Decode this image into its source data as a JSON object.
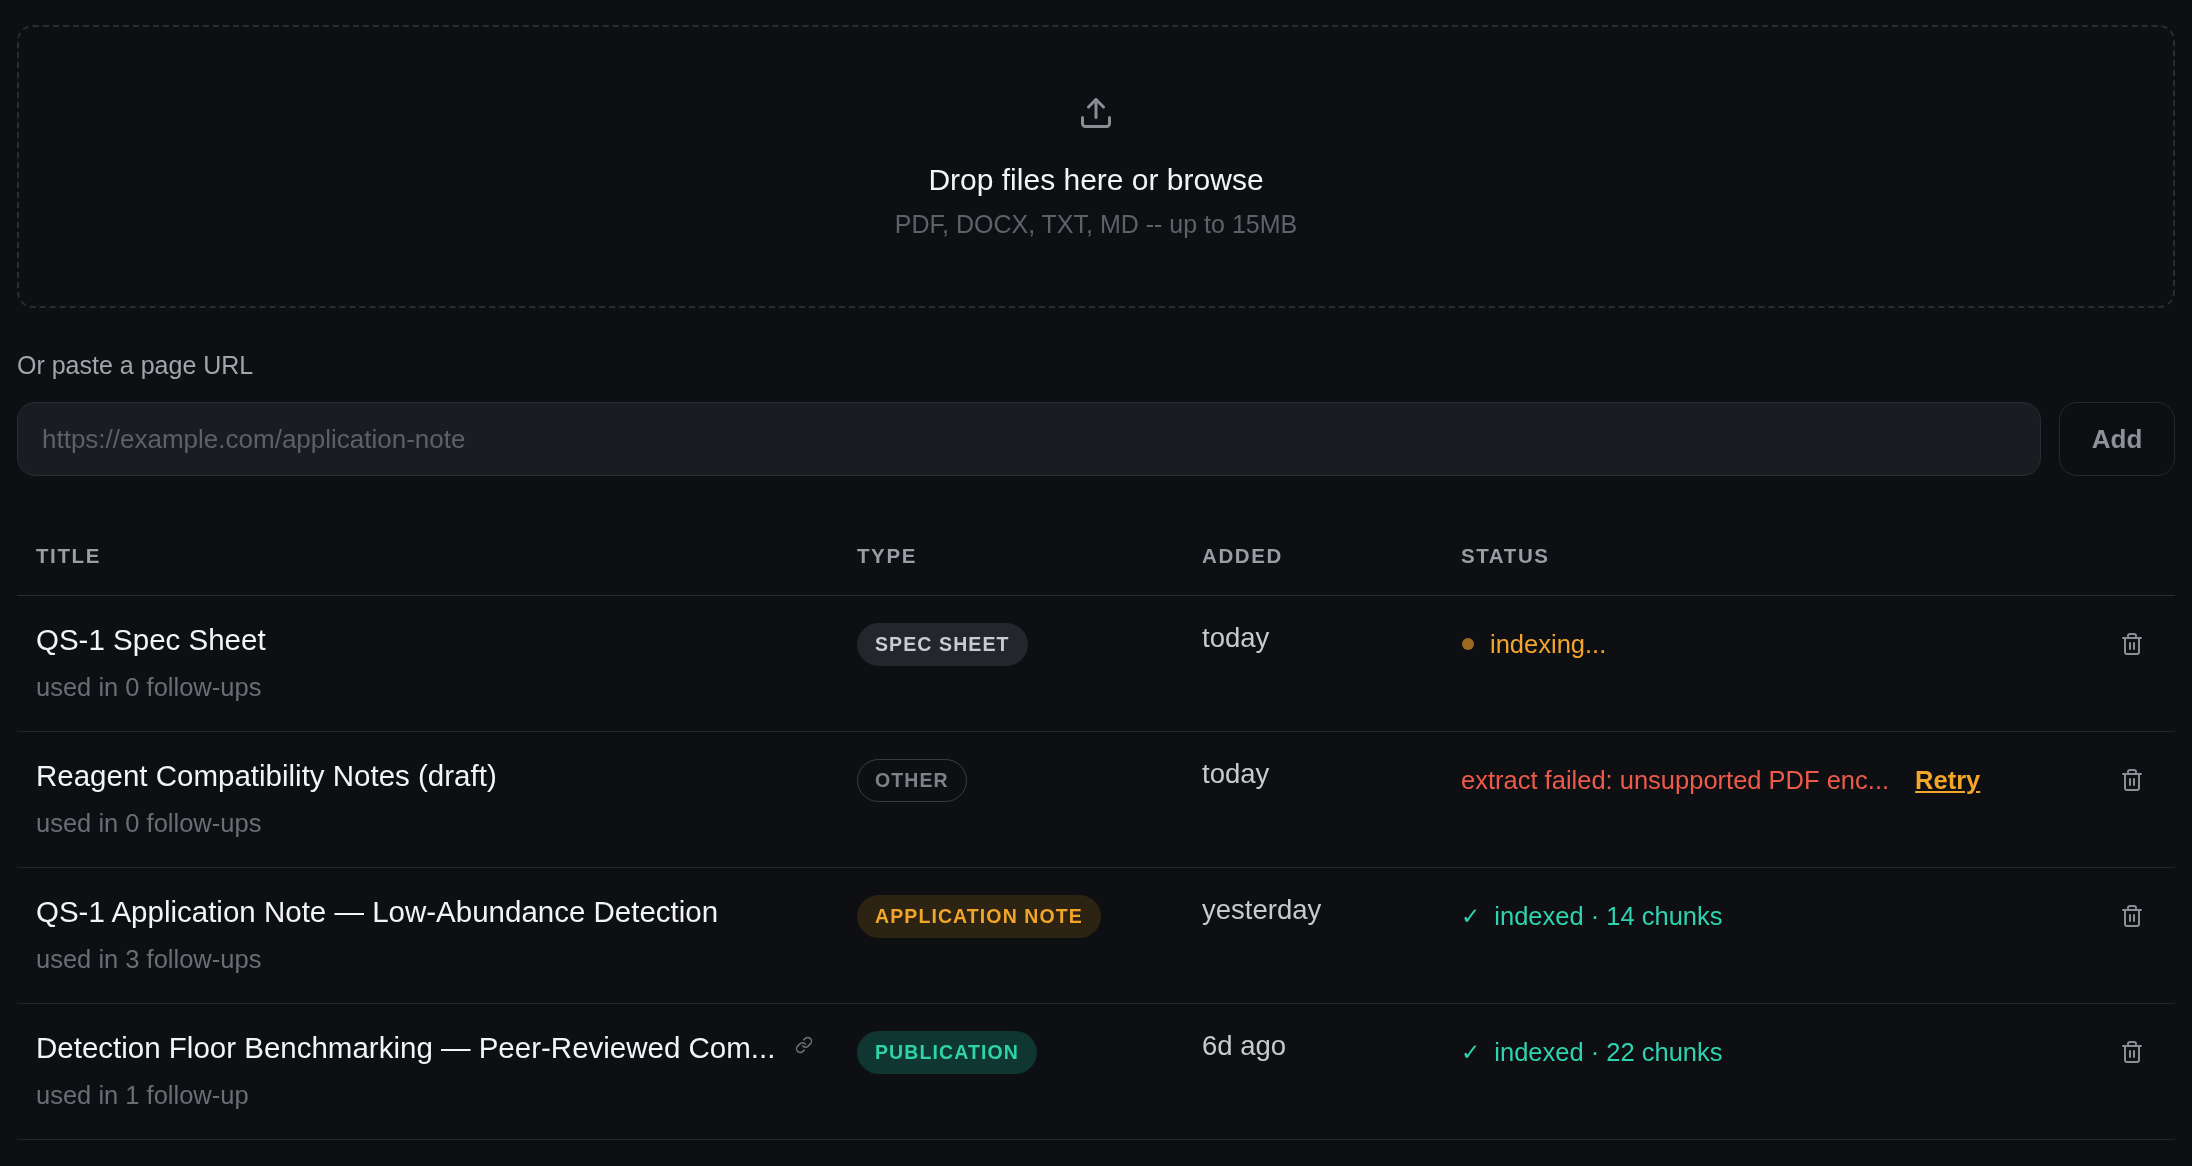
{
  "dropzone": {
    "title": "Drop files here or browse",
    "hint": "PDF, DOCX, TXT, MD -- up to 15MB"
  },
  "url_import": {
    "label": "Or paste a page URL",
    "placeholder": "https://example.com/application-note",
    "button": "Add"
  },
  "table": {
    "columns": [
      "TITLE",
      "TYPE",
      "ADDED",
      "STATUS"
    ],
    "rows": [
      {
        "title": "QS-1 Spec Sheet",
        "usage": "used in 0 follow-ups",
        "linked": false,
        "type": {
          "kind": "spec_sheet",
          "label": "SPEC SHEET"
        },
        "added": "today",
        "status": {
          "kind": "indexing",
          "text": "indexing..."
        }
      },
      {
        "title": "Reagent Compatibility Notes (draft)",
        "usage": "used in 0 follow-ups",
        "linked": false,
        "type": {
          "kind": "other",
          "label": "OTHER"
        },
        "added": "today",
        "status": {
          "kind": "failed",
          "text": "extract failed: unsupported PDF enc...",
          "action": "Retry"
        }
      },
      {
        "title": "QS-1 Application Note — Low-Abundance Detection",
        "usage": "used in 3 follow-ups",
        "linked": false,
        "type": {
          "kind": "application_note",
          "label": "APPLICATION NOTE"
        },
        "added": "yesterday",
        "status": {
          "kind": "indexed",
          "mark": "✓",
          "text": "indexed · 14 chunks"
        }
      },
      {
        "title": "Detection Floor Benchmarking — Peer-Reviewed Com...",
        "usage": "used in 1 follow-up",
        "linked": true,
        "type": {
          "kind": "publication",
          "label": "PUBLICATION"
        },
        "added": "6d ago",
        "status": {
          "kind": "indexed",
          "mark": "✓",
          "text": "indexed · 22 chunks"
        }
      }
    ]
  }
}
